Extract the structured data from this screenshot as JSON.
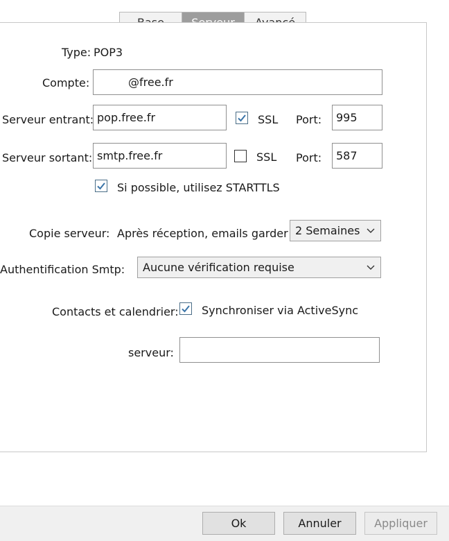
{
  "tabs": [
    {
      "label": "Base"
    },
    {
      "label": "Serveur"
    },
    {
      "label": "Avancé"
    }
  ],
  "type": {
    "label": "Type:",
    "value": "POP3"
  },
  "account": {
    "label": "Compte:",
    "value": "@free.fr"
  },
  "incoming": {
    "label": "Serveur entrant:",
    "host": "pop.free.fr",
    "ssl_label": "SSL",
    "ssl_checked": true,
    "port_label": "Port:",
    "port": "995"
  },
  "outgoing": {
    "label": "Serveur sortant:",
    "host": "smtp.free.fr",
    "ssl_label": "SSL",
    "ssl_checked": false,
    "port_label": "Port:",
    "port": "587"
  },
  "starttls": {
    "label": "Si possible, utilisez STARTTLS",
    "checked": true
  },
  "server_copy": {
    "label": "Copie serveur:",
    "sublabel": "Après réception, emails garder",
    "selected": "2 Semaines"
  },
  "smtp_auth": {
    "label": "Authentification Smtp:",
    "selected": "Aucune vérification requise"
  },
  "contacts": {
    "label": "Contacts et calendrier:",
    "checkbox_label": "Synchroniser via ActiveSync",
    "checked": true
  },
  "sync_server": {
    "label": "serveur:",
    "value": ""
  },
  "footer": {
    "ok_label": "Ok",
    "cancel_label": "Annuler",
    "apply_label": "Appliquer"
  },
  "colors": {
    "active_tab": "#9d9d9d",
    "checkbox_check": "#3a74a8",
    "footer_bg": "#f0f0f0"
  }
}
